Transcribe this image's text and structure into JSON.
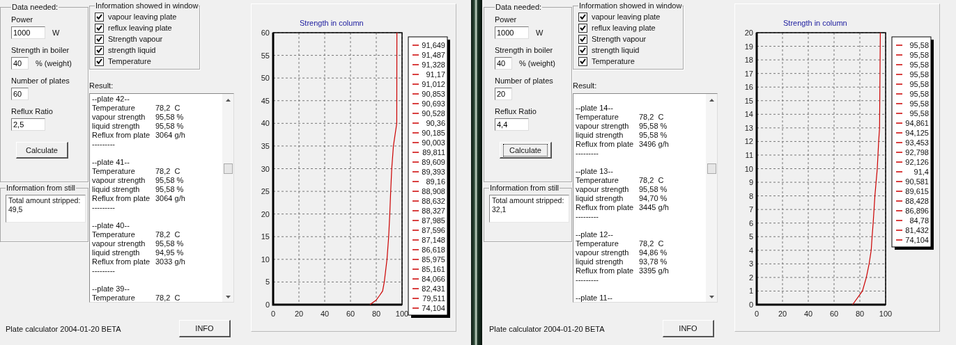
{
  "windows": [
    {
      "data_needed": {
        "title": "Data needed:",
        "fields": [
          {
            "label": "Power",
            "value": "1000",
            "unit": "W"
          },
          {
            "label": "Strength in  boiler",
            "value": "40",
            "unit": "% (weight)"
          },
          {
            "label": "Number of plates",
            "value": "60"
          },
          {
            "label": "Reflux Ratio",
            "value": "2,5"
          }
        ],
        "calculate": {
          "label": "Calculate",
          "focused": false
        }
      },
      "information_window": {
        "title": "Information showed in window",
        "items": [
          {
            "label": "vapour leaving plate",
            "checked": true
          },
          {
            "label": "reflux leaving plate",
            "checked": true
          },
          {
            "label": "Strength vapour",
            "checked": true
          },
          {
            "label": "strength liquid",
            "checked": true
          },
          {
            "label": "Temperature",
            "checked": true
          }
        ]
      },
      "result": {
        "label": "Result:",
        "lines": [
          {
            "kind": "header",
            "text": "--plate 42--"
          },
          {
            "kind": "row",
            "label": "Temperature",
            "value": "78,2  C"
          },
          {
            "kind": "row",
            "label": "vapour strength",
            "value": "95,58 %"
          },
          {
            "kind": "row",
            "label": "liquid strength",
            "value": "95,58 %"
          },
          {
            "kind": "row",
            "label": "Reflux from plate",
            "value": "3064 g/h"
          },
          {
            "kind": "separator",
            "text": "---------"
          },
          {
            "kind": "blank"
          },
          {
            "kind": "header",
            "text": "--plate 41--"
          },
          {
            "kind": "row",
            "label": "Temperature",
            "value": "78,2  C"
          },
          {
            "kind": "row",
            "label": "vapour strength",
            "value": "95,58 %"
          },
          {
            "kind": "row",
            "label": "liquid strength",
            "value": "95,58 %"
          },
          {
            "kind": "row",
            "label": "Reflux from plate",
            "value": "3064 g/h"
          },
          {
            "kind": "separator",
            "text": "---------"
          },
          {
            "kind": "blank"
          },
          {
            "kind": "header",
            "text": "--plate 40--"
          },
          {
            "kind": "row",
            "label": "Temperature",
            "value": "78,2  C"
          },
          {
            "kind": "row",
            "label": "vapour strength",
            "value": "95,58 %"
          },
          {
            "kind": "row",
            "label": "liquid strength",
            "value": "94,95 %"
          },
          {
            "kind": "row",
            "label": "Reflux from plate",
            "value": "3033 g/h"
          },
          {
            "kind": "separator",
            "text": "---------"
          },
          {
            "kind": "blank"
          },
          {
            "kind": "header",
            "text": "--plate 39--"
          },
          {
            "kind": "row",
            "label": "Temperature",
            "value": "78,2  C"
          }
        ]
      },
      "still": {
        "title": "Information from still",
        "lines": [
          "Total amount stripped:",
          "49,5"
        ]
      },
      "status": "Plate calculator 2004-01-20 BETA",
      "info_button": "INFO",
      "chart": {
        "chart_data": {
          "type": "line",
          "title": "Strength in column",
          "grid": true,
          "x": [
            75,
            79.9,
            82.5,
            84.9,
            86.2,
            88.3,
            89.6,
            90.5,
            91.2,
            92,
            93.3,
            95.9,
            96
          ],
          "xlim": [
            0,
            100
          ],
          "ylim": [
            0,
            60
          ],
          "xticks": [
            0,
            20,
            40,
            60,
            80,
            100
          ],
          "yticks": [
            0,
            5,
            10,
            15,
            20,
            25,
            30,
            35,
            40,
            45,
            50,
            55,
            60
          ],
          "series": [
            {
              "color": "#cc0000",
              "values": [
                0,
                1,
                2,
                3,
                5,
                10,
                15,
                20,
                25,
                30,
                35,
                40,
                60
              ]
            }
          ]
        },
        "legend": [
          "91,649",
          "91,487",
          "91,328",
          "91,17",
          "91,012",
          "90,853",
          "90,693",
          "90,528",
          "90,36",
          "90,185",
          "90,003",
          "89,811",
          "89,609",
          "89,393",
          "89,16",
          "88,908",
          "88,632",
          "88,327",
          "87,985",
          "87,596",
          "87,148",
          "86,618",
          "85,975",
          "85,161",
          "84,066",
          "82,431",
          "79,511",
          "74,104"
        ]
      }
    },
    {
      "data_needed": {
        "title": "Data needed:",
        "fields": [
          {
            "label": "Power",
            "value": "1000",
            "unit": "W"
          },
          {
            "label": "Strength in  boiler",
            "value": "40",
            "unit": "% (weight)"
          },
          {
            "label": "Number of plates",
            "value": "20"
          },
          {
            "label": "Reflux Ratio",
            "value": "4,4"
          }
        ],
        "calculate": {
          "label": "Calculate",
          "focused": true
        }
      },
      "information_window": {
        "title": "Information showed in window",
        "items": [
          {
            "label": "vapour leaving plate",
            "checked": true
          },
          {
            "label": "reflux leaving plate",
            "checked": true
          },
          {
            "label": "Strength vapour",
            "checked": true
          },
          {
            "label": "strength liquid",
            "checked": true
          },
          {
            "label": "Temperature",
            "checked": true
          }
        ]
      },
      "result": {
        "label": "Result:",
        "lines": [
          {
            "kind": "blank"
          },
          {
            "kind": "header",
            "text": "--plate 14--"
          },
          {
            "kind": "row",
            "label": "Temperature",
            "value": "78,2  C"
          },
          {
            "kind": "row",
            "label": "vapour strength",
            "value": "95,58 %"
          },
          {
            "kind": "row",
            "label": "liquid strength",
            "value": "95,58 %"
          },
          {
            "kind": "row",
            "label": "Reflux from plate",
            "value": "3496 g/h"
          },
          {
            "kind": "separator",
            "text": "---------"
          },
          {
            "kind": "blank"
          },
          {
            "kind": "header",
            "text": "--plate 13--"
          },
          {
            "kind": "row",
            "label": "Temperature",
            "value": "78,2  C"
          },
          {
            "kind": "row",
            "label": "vapour strength",
            "value": "95,58 %"
          },
          {
            "kind": "row",
            "label": "liquid strength",
            "value": "94,70 %"
          },
          {
            "kind": "row",
            "label": "Reflux from plate",
            "value": "3445 g/h"
          },
          {
            "kind": "separator",
            "text": "---------"
          },
          {
            "kind": "blank"
          },
          {
            "kind": "header",
            "text": "--plate 12--"
          },
          {
            "kind": "row",
            "label": "Temperature",
            "value": "78,2  C"
          },
          {
            "kind": "row",
            "label": "vapour strength",
            "value": "94,86 %"
          },
          {
            "kind": "row",
            "label": "liquid strength",
            "value": "93,78 %"
          },
          {
            "kind": "row",
            "label": "Reflux from plate",
            "value": "3395 g/h"
          },
          {
            "kind": "separator",
            "text": "---------"
          },
          {
            "kind": "blank"
          },
          {
            "kind": "header",
            "text": "--plate 11--"
          }
        ]
      },
      "still": {
        "title": "Information from still",
        "lines": [
          "Total amount stripped:",
          "32,1"
        ]
      },
      "status": "Plate calculator 2004-01-20 BETA",
      "info_button": "INFO",
      "chart": {
        "chart_data": {
          "type": "line",
          "title": "Strength in column",
          "grid": true,
          "x": [
            74.4,
            82,
            85,
            87.2,
            88.8,
            89.5,
            90.3,
            91.7,
            93.5,
            94.6,
            95.3,
            95.9
          ],
          "xlim": [
            0,
            100
          ],
          "ylim": [
            0,
            20
          ],
          "xticks": [
            0,
            20,
            40,
            60,
            80,
            100
          ],
          "yticks": [
            0,
            1,
            2,
            3,
            4,
            5,
            6,
            7,
            8,
            9,
            10,
            11,
            12,
            13,
            14,
            15,
            16,
            17,
            18,
            19,
            20
          ],
          "series": [
            {
              "color": "#cc0000",
              "values": [
                0,
                1,
                2,
                3,
                4,
                5,
                6,
                8,
                10,
                12,
                13,
                20
              ]
            }
          ]
        },
        "legend": [
          "95,58",
          "95,58",
          "95,58",
          "95,58",
          "95,58",
          "95,58",
          "95,58",
          "95,58",
          "94,861",
          "94,125",
          "93,453",
          "92,798",
          "92,126",
          "91,4",
          "90,581",
          "89,615",
          "88,428",
          "86,896",
          "84,78",
          "81,432",
          "74,104"
        ]
      }
    }
  ]
}
